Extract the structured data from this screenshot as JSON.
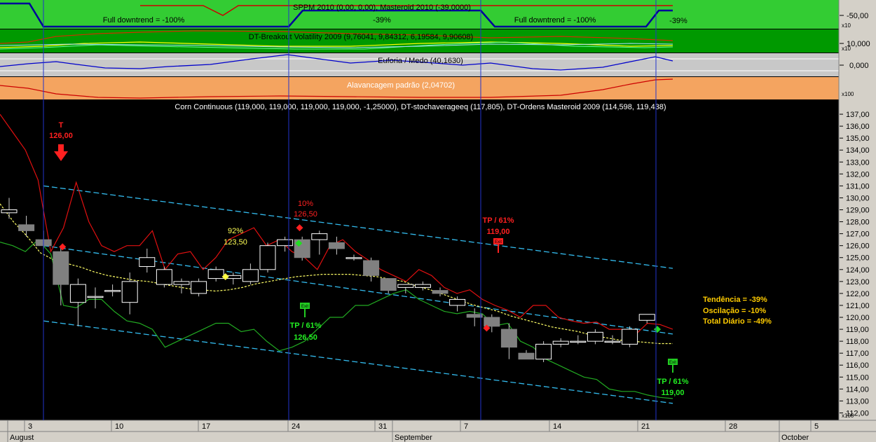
{
  "colors": {
    "sppm_bg": "#33cc33",
    "vol_bg": "#009900",
    "euforia_bg": "#c8c8c8",
    "alav_bg": "#f4a460",
    "main_bg": "#000000",
    "sppm_line_blue": "#000099",
    "sppm_line_red": "#cc0000",
    "channel": "#33bbee",
    "stoch": "#ffff66",
    "ordens_upper": "#e01010",
    "ordens_lower": "#22aa22",
    "vline": "#2233cc",
    "up_fill": "#ffffff",
    "down_fill": "#808080"
  },
  "panels": {
    "sppm": {
      "title": "SPPM 2010 (0,00, 0,00), Masteroid 2010 (-39,0000)",
      "left_label": "Full downtrend = -100%",
      "mid_label": "-39%",
      "right_label": "Full downtrend = -100%",
      "edge_label": "-39%",
      "axis_value": "-50,00",
      "axis_mult": "x10"
    },
    "volatility": {
      "title": "DT-Breakout Volatility 2009 (9,76041, 9,84312, 6,19584, 9,90608)",
      "axis_value": "10,000",
      "axis_mult": "x10"
    },
    "euforia": {
      "title": "Euforia / Medo (40,1630)",
      "axis_value": "0,000"
    },
    "alavancagem": {
      "title": "Alavancagem padrão (2,04702)",
      "axis_mult": "x100"
    },
    "main": {
      "title": "Corn Continuous (119,000, 119,000, 119,000, 119,000, -1,25000), DT-stochaverageeq (117,805), DT-Ordens Masteroid 2009 (114,598, 119,438)",
      "price_axis_mult": "x100"
    }
  },
  "annotations": {
    "sell1_letter": "T",
    "sell1_price": "126,00",
    "pct1": "92%",
    "pct1_price": "123,50",
    "pct2": "10%",
    "pct2_price": "126,50",
    "tp_high_label": "TP / 61%",
    "tp_high_price": "119,00",
    "exit_badge": "Exit",
    "tp_low1_label": "TP / 61%",
    "tp_low1_price": "126,50",
    "tp_low2_label": "TP / 61%",
    "tp_low2_price": "119,00",
    "stats": [
      "Tendência = -39%",
      "Oscilação = -10%",
      "Total Diário = -49%"
    ]
  },
  "xaxis": {
    "day_labels": [
      "3",
      "10",
      "17",
      "24",
      "31",
      "7",
      "14",
      "21",
      "28",
      "5"
    ],
    "month_labels": [
      "August",
      "September",
      "October"
    ]
  },
  "chart_data": {
    "type": "candlestick",
    "title": "Corn Continuous (119,000, 119,000, 119,000, 119,000, -1,25000), DT-stochaverageeq (117,805), DT-Ordens Masteroid 2009 (114,598, 119,438)",
    "xlabel": "",
    "ylabel": "",
    "ylim": [
      111.5,
      138
    ],
    "y_ticks": [
      "112,00",
      "113,00",
      "114,00",
      "115,00",
      "116,00",
      "117,00",
      "118,00",
      "119,00",
      "120,00",
      "121,00",
      "122,00",
      "123,00",
      "124,00",
      "125,00",
      "126,00",
      "127,00",
      "128,00",
      "129,00",
      "130,00",
      "131,00",
      "132,00",
      "133,00",
      "134,00",
      "135,00",
      "136,00",
      "137,00"
    ],
    "candles": [
      {
        "o": 128.75,
        "h": 130.0,
        "l": 128.25,
        "c": 129.0
      },
      {
        "o": 127.75,
        "h": 128.5,
        "l": 126.75,
        "c": 127.25
      },
      {
        "o": 126.5,
        "h": 127.25,
        "l": 125.75,
        "c": 126.0
      },
      {
        "o": 125.5,
        "h": 126.0,
        "l": 121.0,
        "c": 122.75
      },
      {
        "o": 121.25,
        "h": 123.25,
        "l": 119.25,
        "c": 122.75
      },
      {
        "o": 121.75,
        "h": 122.5,
        "l": 120.75,
        "c": 121.75
      },
      {
        "o": 122.25,
        "h": 122.75,
        "l": 121.75,
        "c": 122.25
      },
      {
        "o": 121.25,
        "h": 123.75,
        "l": 120.25,
        "c": 123.0
      },
      {
        "o": 124.25,
        "h": 125.75,
        "l": 123.75,
        "c": 125.0
      },
      {
        "o": 122.75,
        "h": 124.25,
        "l": 122.5,
        "c": 124.0
      },
      {
        "o": 122.75,
        "h": 123.25,
        "l": 122.0,
        "c": 123.0
      },
      {
        "o": 122.0,
        "h": 123.25,
        "l": 121.75,
        "c": 123.0
      },
      {
        "o": 123.25,
        "h": 124.25,
        "l": 123.0,
        "c": 124.0
      },
      {
        "o": 123.25,
        "h": 123.75,
        "l": 122.75,
        "c": 123.5
      },
      {
        "o": 123.0,
        "h": 124.5,
        "l": 122.75,
        "c": 124.0
      },
      {
        "o": 124.0,
        "h": 126.25,
        "l": 123.75,
        "c": 126.0
      },
      {
        "o": 126.0,
        "h": 126.75,
        "l": 125.5,
        "c": 126.5
      },
      {
        "o": 126.5,
        "h": 126.75,
        "l": 124.75,
        "c": 125.0
      },
      {
        "o": 126.5,
        "h": 127.25,
        "l": 125.25,
        "c": 127.0
      },
      {
        "o": 126.25,
        "h": 126.75,
        "l": 125.25,
        "c": 125.75
      },
      {
        "o": 125.0,
        "h": 125.25,
        "l": 124.75,
        "c": 125.0
      },
      {
        "o": 124.75,
        "h": 125.0,
        "l": 123.0,
        "c": 123.5
      },
      {
        "o": 123.25,
        "h": 123.25,
        "l": 122.0,
        "c": 122.25
      },
      {
        "o": 122.5,
        "h": 122.75,
        "l": 122.0,
        "c": 122.75
      },
      {
        "o": 122.5,
        "h": 123.0,
        "l": 122.25,
        "c": 122.75
      },
      {
        "o": 122.25,
        "h": 122.5,
        "l": 121.75,
        "c": 122.0
      },
      {
        "o": 121.0,
        "h": 121.75,
        "l": 120.5,
        "c": 121.5
      },
      {
        "o": 120.25,
        "h": 120.75,
        "l": 119.25,
        "c": 120.0
      },
      {
        "o": 120.0,
        "h": 120.25,
        "l": 118.75,
        "c": 119.25
      },
      {
        "o": 119.0,
        "h": 119.5,
        "l": 116.5,
        "c": 117.5
      },
      {
        "o": 117.0,
        "h": 117.25,
        "l": 116.5,
        "c": 116.5
      },
      {
        "o": 116.5,
        "h": 118.0,
        "l": 116.25,
        "c": 117.75
      },
      {
        "o": 117.75,
        "h": 118.25,
        "l": 117.5,
        "c": 118.0
      },
      {
        "o": 118.0,
        "h": 118.5,
        "l": 117.75,
        "c": 118.0
      },
      {
        "o": 118.0,
        "h": 119.0,
        "l": 117.75,
        "c": 118.75
      },
      {
        "o": 118.0,
        "h": 118.5,
        "l": 117.75,
        "c": 118.0
      },
      {
        "o": 117.75,
        "h": 119.25,
        "l": 117.5,
        "c": 119.0
      },
      {
        "o": 119.75,
        "h": 120.25,
        "l": 119.5,
        "c": 120.25
      }
    ],
    "series": [
      {
        "values": [
          137.0,
          135.5,
          134.0,
          131.5,
          125.5,
          127.5,
          131.3,
          128.0,
          126.0,
          125.5,
          126.0,
          126.0,
          127.25,
          124.0,
          125.3,
          125.5,
          124.0,
          125.0,
          126.5,
          127.0,
          127.5,
          126.0,
          126.5,
          125.5,
          125.0,
          124.0,
          126.0,
          126.5,
          125.5,
          124.8,
          124.0,
          123.5,
          123.0,
          124.0,
          123.5,
          122.5,
          122.0,
          122.3,
          121.5,
          121.0,
          120.6,
          120.0,
          121.0,
          121.0,
          120.0,
          119.7,
          119.5,
          119.6,
          119.0,
          119.0,
          118.5,
          119.5,
          119.4,
          119.0
        ]
      },
      {
        "values": [
          126.3,
          126.0,
          125.5,
          126.5,
          125.3,
          121.0,
          120.8,
          121.5,
          121.5,
          120.5,
          119.7,
          119.5,
          119.0,
          117.5,
          118.0,
          118.5,
          119.0,
          119.5,
          119.5,
          118.8,
          119.0,
          118.0,
          117.2,
          117.5,
          118.0,
          119.0,
          120.0,
          120.0,
          121.0,
          121.0,
          121.5,
          122.0,
          122.3,
          121.5,
          121.0,
          120.5,
          120.3,
          120.5,
          120.3,
          119.3,
          119.5,
          118.0,
          117.5,
          116.5,
          116.0,
          115.5,
          115.0,
          114.8,
          114.0,
          113.8,
          113.8,
          113.5,
          113.3,
          113.2
        ]
      },
      {
        "values": [
          129.5,
          128.0,
          126.8,
          125.4,
          124.8,
          124.5,
          124.2,
          123.8,
          123.5,
          123.3,
          123.1,
          123.0,
          122.8,
          122.6,
          122.4,
          122.3,
          122.2,
          122.3,
          122.5,
          122.8,
          123.0,
          123.2,
          123.4,
          123.5,
          123.6,
          123.6,
          123.6,
          123.5,
          123.4,
          123.2,
          123.0,
          122.6,
          122.3,
          121.9,
          121.5,
          121.1,
          120.8,
          120.5,
          120.1,
          119.8,
          119.5,
          119.2,
          119.0,
          118.8,
          118.5,
          118.3,
          118.1,
          118.0,
          117.9,
          117.8,
          117.8
        ]
      }
    ],
    "channel_lines": [
      {
        "from": [
          0,
          131.0
        ],
        "to": [
          37,
          124.1
        ]
      },
      {
        "from": [
          0,
          126.0
        ],
        "to": [
          37,
          118.6
        ]
      },
      {
        "from": [
          0,
          119.7
        ],
        "to": [
          37,
          112.8
        ]
      }
    ],
    "markers": [
      {
        "x": 3.1,
        "y": 125.9,
        "color": "#ff2020"
      },
      {
        "x": 12.55,
        "y": 123.4,
        "color": "#ffff44"
      },
      {
        "x": 16.8,
        "y": 126.2,
        "color": "#22dd22"
      },
      {
        "x": 16.85,
        "y": 127.5,
        "color": "#ff2020"
      },
      {
        "x": 27.7,
        "y": 119.1,
        "color": "#ff2020"
      },
      {
        "x": 37.6,
        "y": 119.0,
        "color": "#22dd22"
      }
    ],
    "vlines": [
      1.4,
      15.3,
      26.3,
      36.3
    ]
  }
}
